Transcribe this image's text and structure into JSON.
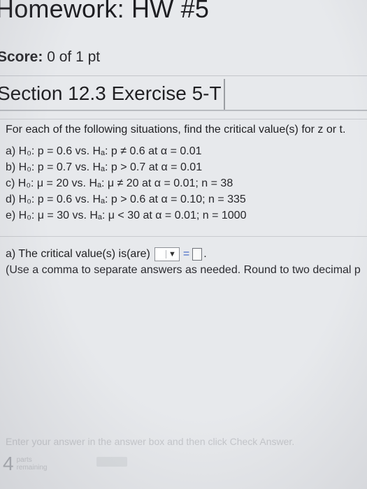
{
  "header": {
    "title": "Homework: HW #5"
  },
  "score": {
    "label": "Score:",
    "value": "0 of 1 pt"
  },
  "section": {
    "title": "Section 12.3 Exercise 5-T"
  },
  "question": {
    "prompt": "For each of the following situations, find the critical value(s) for z or t.",
    "items": [
      "a) H₀: p = 0.6 vs. Hₐ: p ≠ 0.6 at α = 0.01",
      "b) H₀: p = 0.7 vs. Hₐ: p > 0.7 at α = 0.01",
      "c) H₀: μ = 20 vs. Hₐ: μ ≠ 20 at α = 0.01; n = 38",
      "d) H₀: p = 0.6 vs. Hₐ: p > 0.6 at α = 0.10; n = 335",
      "e) H₀: μ = 30 vs. Hₐ: μ < 30 at α = 0.01; n = 1000"
    ]
  },
  "answer": {
    "label": "a) The critical value(s) is(are)",
    "dropdown_caret": "▼",
    "relation": "=",
    "input_value": "",
    "period": ".",
    "instruction": "(Use a comma to separate answers as needed. Round to two decimal p"
  },
  "footer": {
    "hint": "Enter your answer in the answer box and then click Check Answer.",
    "parts_count": "4",
    "parts_label_line1": "parts",
    "parts_label_line2": "remaining"
  }
}
